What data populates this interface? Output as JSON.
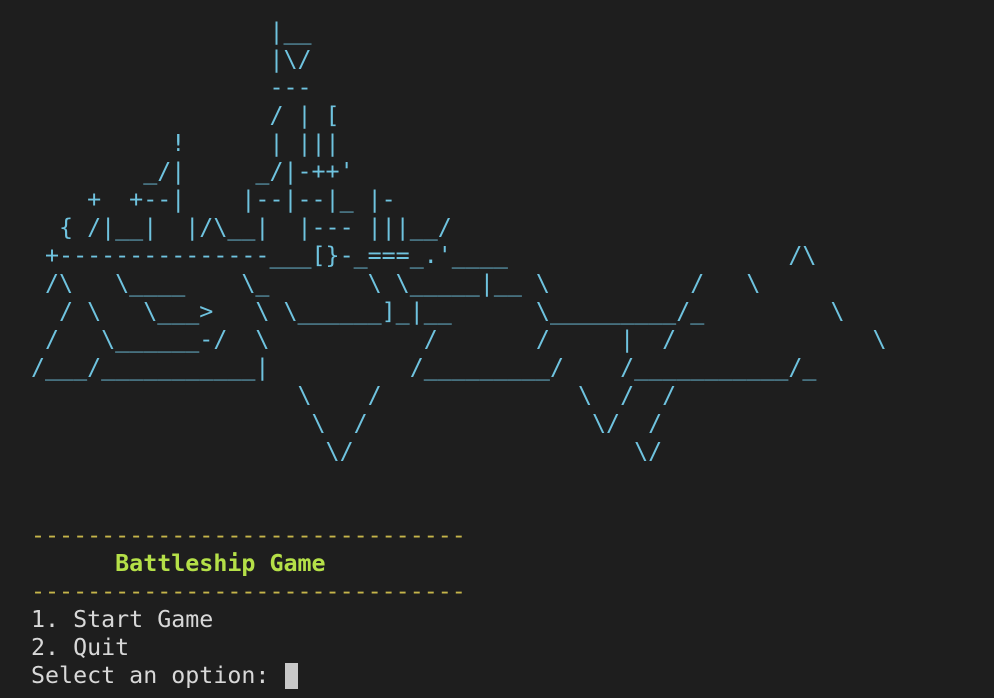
{
  "colors": {
    "background": "#1e1e1e",
    "ship": "#6fc3df",
    "rule": "#c6b54a",
    "title": "#b5e048",
    "text": "#d8d8d8",
    "cursor": "#c8c8c8"
  },
  "ascii_art": [
    "                 |__",
    "                 |\\/",
    "                 ---",
    "                 / | [",
    "          !      | |||",
    "        _/|     _/|-++'",
    "    +  +--|    |--|--|_ |-",
    "  { /|__|  |/\\__|  |--- |||__/",
    " +---------------___[}-_===_.'____                    /\\",
    " /\\   \\____    \\_       \\ \\_____|__ \\          /   \\",
    "  / \\   \\___>   \\ \\______]_|__      \\_________/_         \\",
    " /   \\______-/  \\           /       /     |  /              \\",
    "/___/___________|          /_________/    /___________/_",
    "                   \\    /              \\  /  /",
    "                    \\  /                \\/  /",
    "                     \\/                    \\/"
  ],
  "gap_lines": [
    "",
    ""
  ],
  "menu": {
    "rule_top": "-------------------------------",
    "title": "      Battleship Game",
    "rule_bottom": "-------------------------------",
    "options": [
      "1. Start Game",
      "2. Quit"
    ],
    "prompt": "Select an option: "
  }
}
